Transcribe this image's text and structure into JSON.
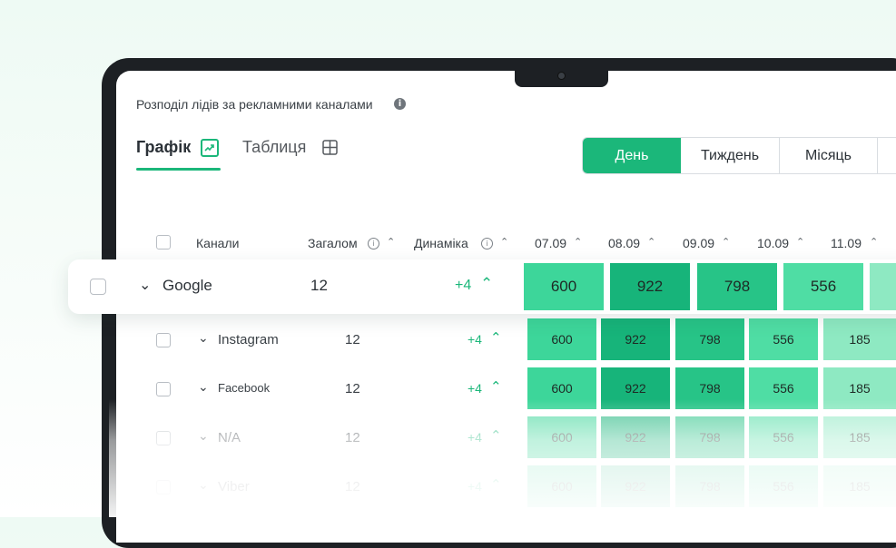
{
  "panel": {
    "title": "Розподіл лідів за рекламними каналами",
    "info_icon": "i"
  },
  "tabs": [
    {
      "label": "Графік",
      "icon": "chart-trend-icon",
      "active": true
    },
    {
      "label": "Таблиця",
      "icon": "table-grid-icon",
      "active": false
    }
  ],
  "period": {
    "options": [
      "День",
      "Тиждень",
      "Місяць"
    ],
    "selected": "День"
  },
  "table": {
    "headers": {
      "channels": "Канали",
      "total": "Загалом",
      "dynamics": "Динаміка",
      "dates": [
        "07.09",
        "08.09",
        "09.09",
        "10.09",
        "11.09"
      ]
    },
    "rows": [
      {
        "name": "Google",
        "total": "12",
        "dynamics": "+4",
        "values": [
          "600",
          "922",
          "798",
          "556",
          ""
        ]
      },
      {
        "name": "Instagram",
        "total": "12",
        "dynamics": "+4",
        "values": [
          "600",
          "922",
          "798",
          "556",
          "185"
        ]
      },
      {
        "name": "Facebook",
        "total": "12",
        "dynamics": "+4",
        "values": [
          "600",
          "922",
          "798",
          "556",
          "185"
        ]
      },
      {
        "name": "N/A",
        "total": "12",
        "dynamics": "+4",
        "values": [
          "600",
          "922",
          "798",
          "556",
          "185"
        ]
      },
      {
        "name": "Viber",
        "total": "12",
        "dynamics": "+4",
        "values": [
          "600",
          "922",
          "798",
          "556",
          "185"
        ]
      }
    ]
  },
  "colors": {
    "accent": "#1bb77a",
    "heat_600": "#3dd69a",
    "heat_922": "#17b47a",
    "heat_798": "#27c487",
    "heat_556": "#4fdda4",
    "heat_185": "#8ee9c2"
  }
}
